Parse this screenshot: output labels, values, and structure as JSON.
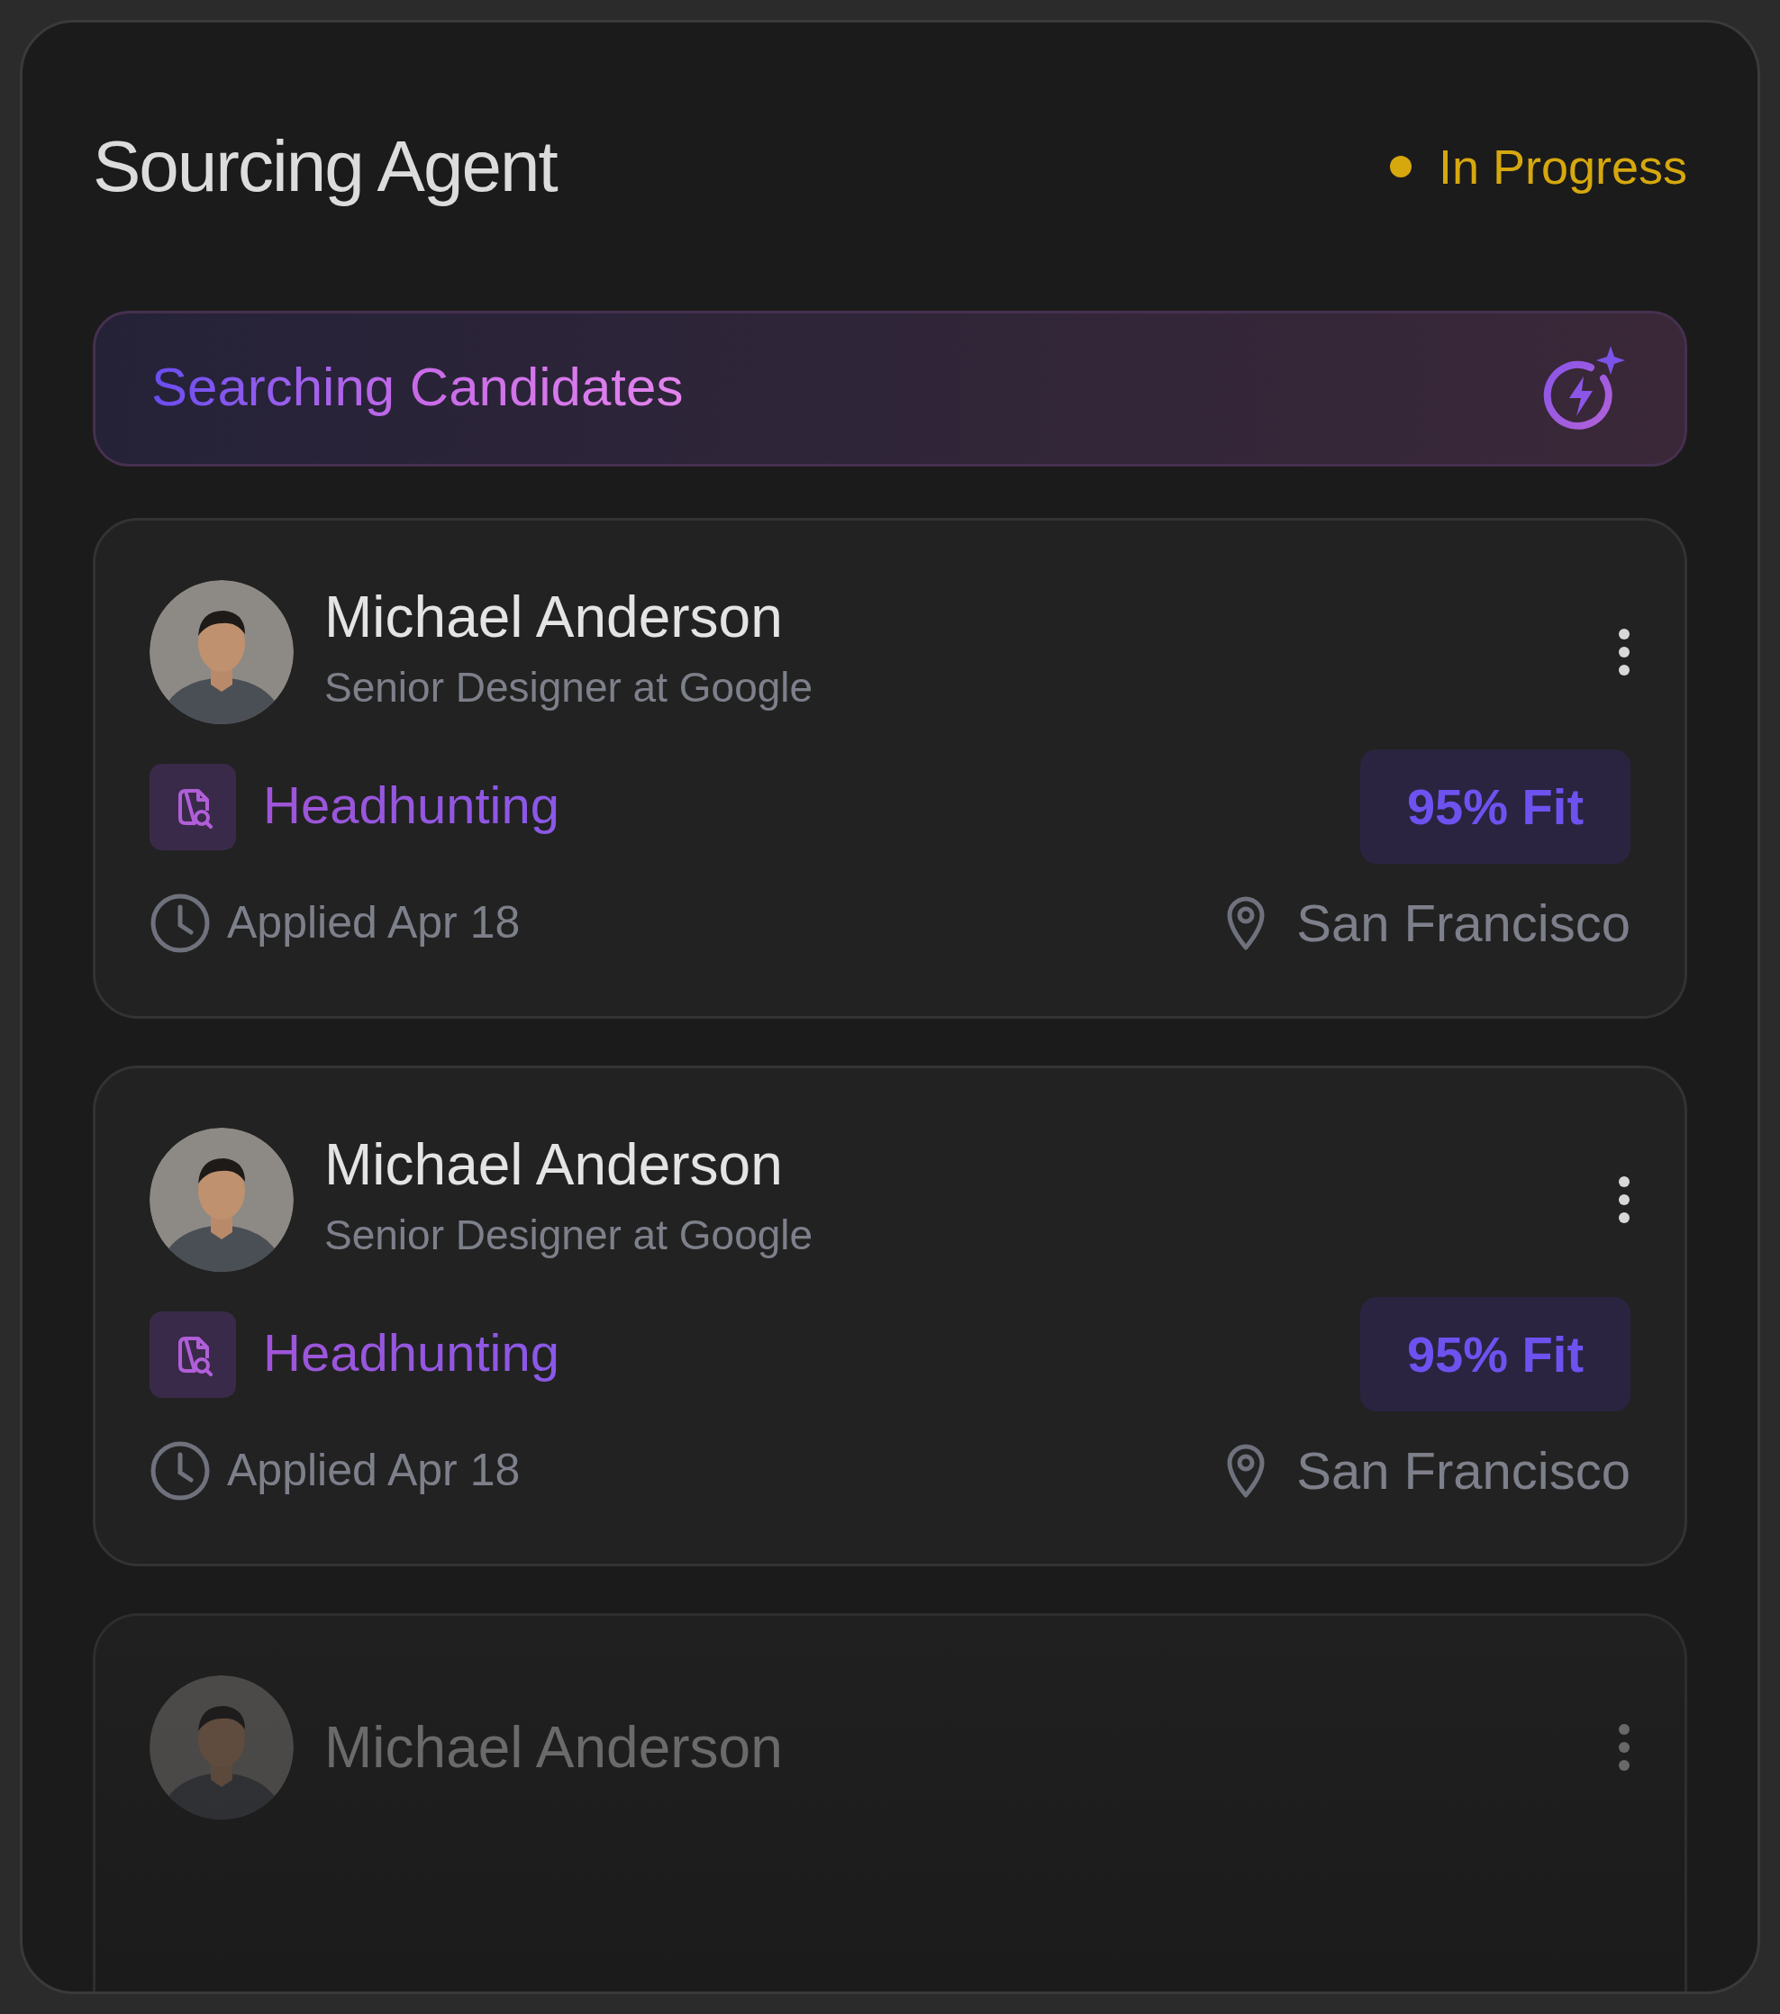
{
  "header": {
    "title": "Sourcing Agent",
    "status": {
      "label": "In Progress",
      "color": "#d6a80e"
    }
  },
  "banner": {
    "label": "Searching Candidates"
  },
  "candidates": [
    {
      "kind": "full",
      "name": "Michael Anderson",
      "role": "Senior Designer at Google",
      "tag": "Headhunting",
      "fit": "95% Fit",
      "applied": "Applied Apr 18",
      "location": "San Francisco"
    },
    {
      "kind": "full",
      "name": "Michael Anderson",
      "role": "Senior Designer at Google",
      "tag": "Headhunting",
      "fit": "95% Fit",
      "applied": "Applied Apr 18",
      "location": "San Francisco"
    },
    {
      "kind": "faded",
      "name": "Michael Anderson"
    }
  ]
}
